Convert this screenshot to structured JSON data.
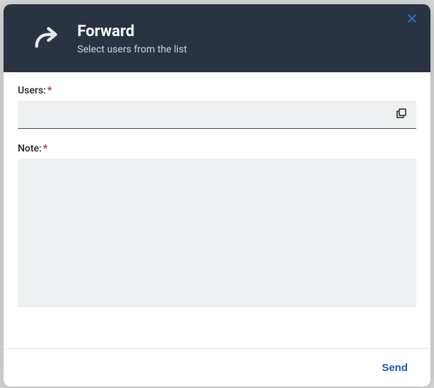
{
  "header": {
    "title": "Forward",
    "subtitle": "Select users from the list"
  },
  "fields": {
    "users": {
      "label": "Users:",
      "value": ""
    },
    "note": {
      "label": "Note:",
      "value": ""
    }
  },
  "footer": {
    "send_label": "Send"
  }
}
